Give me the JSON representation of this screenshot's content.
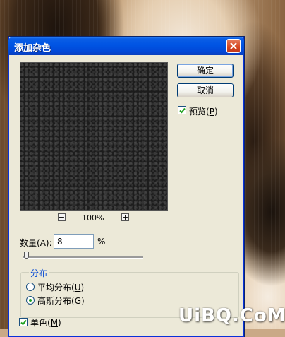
{
  "dialog": {
    "title": "添加杂色",
    "close_label": "×"
  },
  "buttons": {
    "ok_label": "确定",
    "cancel_label": "取消"
  },
  "preview": {
    "label_prefix": "预览(",
    "mnemonic": "P",
    "label_suffix": ")",
    "checked": true
  },
  "zoom": {
    "minus": "−",
    "plus": "+",
    "value": "100%"
  },
  "amount": {
    "label_prefix": "数量(",
    "mnemonic": "A",
    "label_suffix": "):",
    "value": "8",
    "unit": "%",
    "slider_fraction": 0.02
  },
  "distribution": {
    "title": "分布",
    "options": [
      {
        "label_prefix": "平均分布(",
        "mnemonic": "U",
        "label_suffix": ")",
        "selected": false
      },
      {
        "label_prefix": "高斯分布(",
        "mnemonic": "G",
        "label_suffix": ")",
        "selected": true
      }
    ]
  },
  "monochromatic": {
    "label_prefix": "单色(",
    "mnemonic": "M",
    "label_suffix": ")",
    "checked": true
  },
  "watermark": {
    "text": "UiBQ.CoM"
  },
  "colors": {
    "title_bar": "#0054e3",
    "dialog_bg": "#ece9d8",
    "radio_dot": "#21a121",
    "group_title": "#0046d5"
  }
}
